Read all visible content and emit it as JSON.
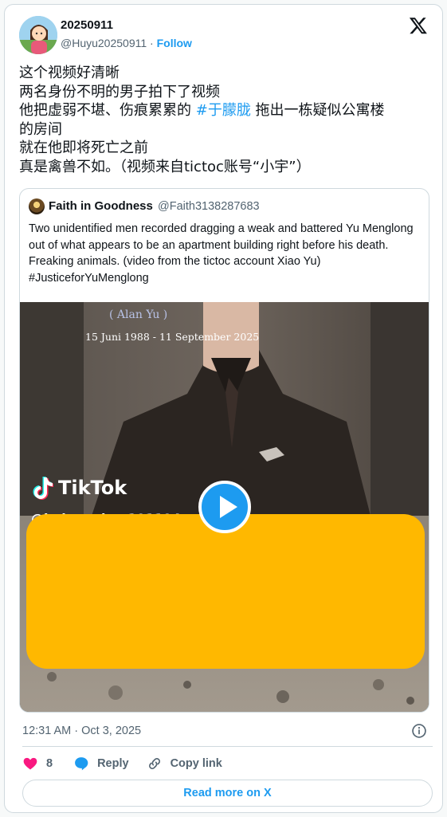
{
  "author": {
    "name": "20250911",
    "handle": "@Huyu20250911",
    "separator": "·",
    "follow_label": "Follow"
  },
  "tweet": {
    "line1": "这个视频好清晰",
    "line2": "两名身份不明的男子拍下了视频",
    "line3_before": "他把虚弱不堪、伤痕累累的 ",
    "line3_hashtag": "#于朦胧",
    "line3_after": " 拖出一栋疑似公寓楼",
    "line4": "的房间",
    "line5": "就在他即将死亡之前",
    "line6": "真是禽兽不如。（视频来自tictoc账号“小宇”）"
  },
  "quote": {
    "name": "Faith in Goodness",
    "handle": "@Faith3138287683",
    "text": "Two unidentified men recorded dragging a weak and battered Yu Menglong out of what appears to be an apartment building right before his death. Freaking animals. (video from the tictoc account Xiao Yu) #JusticeforYuMenglong",
    "media": {
      "watermark_name": "( Alan Yu )",
      "watermark_dates": "15 Juni 1988 - 11 September 2025",
      "tiktok_label": "TikTok",
      "tiktok_handle": "@baiqnovhee101194"
    }
  },
  "timestamp": "12:31 AM · Oct 3, 2025",
  "actions": {
    "like_count": "8",
    "reply_label": "Reply",
    "copy_label": "Copy link"
  },
  "read_more_label": "Read more on X",
  "colors": {
    "accent": "#1d9bf0",
    "heart": "#f91880",
    "redaction": "#ffb800"
  },
  "icons": [
    "x-logo-icon",
    "heart-icon",
    "reply-icon",
    "link-icon",
    "info-icon",
    "play-icon",
    "tiktok-icon"
  ]
}
